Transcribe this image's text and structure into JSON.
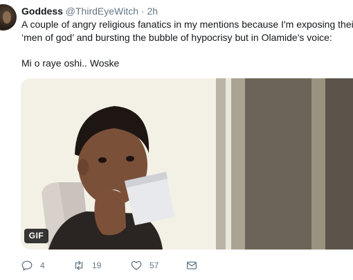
{
  "tweet": {
    "author_name": "Goddess",
    "author_handle": "@ThirdEyeWitch",
    "separator": "·",
    "time": "2h",
    "text_line1": "A couple of angry religious fanatics in my mentions because I'm exposing their",
    "text_line2": "‘men of god’ and bursting the bubble of hypocrisy but in Olamide's voice:",
    "text_line3": "Mi o raye oshi.. Woske",
    "media_badge": "GIF"
  },
  "actions": {
    "reply_count": "4",
    "retweet_count": "19",
    "like_count": "57"
  },
  "icons": {
    "reply": "reply-icon",
    "retweet": "retweet-icon",
    "like": "heart-icon",
    "dm": "envelope-icon"
  },
  "colors": {
    "icon": "#657786",
    "text": "#14171a",
    "muted": "#657786"
  }
}
